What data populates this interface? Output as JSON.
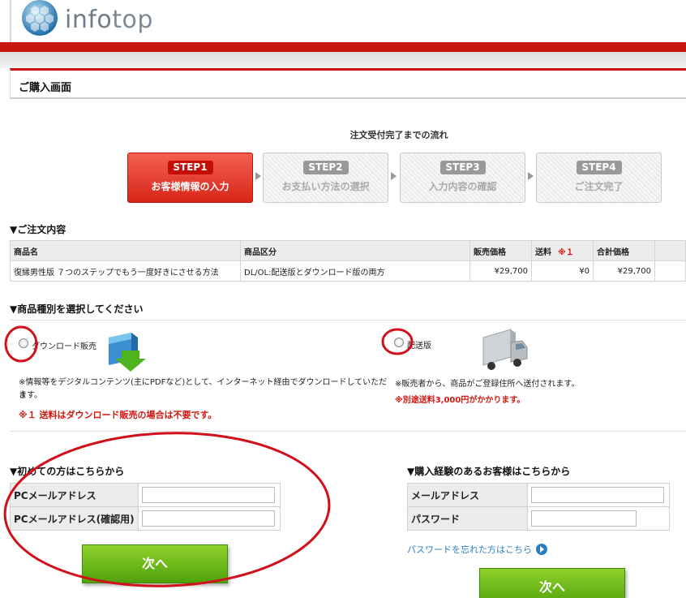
{
  "header": {
    "logo_text_main": "info",
    "logo_text_accent": "top"
  },
  "page_title": "ご購入画面",
  "flow": {
    "title": "注文受付完了までの流れ",
    "steps": [
      {
        "badge": "STEP1",
        "label": "お客様情報の入力",
        "active": true
      },
      {
        "badge": "STEP2",
        "label": "お支払い方法の選択",
        "active": false
      },
      {
        "badge": "STEP3",
        "label": "入力内容の確認",
        "active": false
      },
      {
        "badge": "STEP4",
        "label": "ご注文完了",
        "active": false
      }
    ]
  },
  "order": {
    "heading": "▼ご注文内容",
    "columns": [
      "商品名",
      "商品区分",
      "販売価格",
      "送料",
      "※１",
      "合計価格"
    ],
    "row": {
      "name": "復縁男性版 ７つのステップでもう一度好きにさせる方法",
      "category": "DL/OL:配送版とダウンロード版の両方",
      "price": "¥29,700",
      "shipping": "¥0",
      "total": "¥29,700"
    }
  },
  "product_type": {
    "heading": "▼商品種別を選択してください",
    "download_label": "ダウンロード販売",
    "download_note": "※情報等をデジタルコンテンツ(主にPDFなど)として、インターネット経由でダウンロードしていただき",
    "download_note2": "ます。",
    "shipping_note_red": "※１ 送料はダウンロード販売の場合は不要です。",
    "delivery_label": "配送版",
    "delivery_note": "※販売者から、商品がご登録住所へ送付されます。",
    "delivery_note_red": "※別途送料3,000円がかかります。"
  },
  "new_customer": {
    "heading": "▼初めての方はこちらから",
    "email_label": "PCメールアドレス",
    "email_value": "",
    "email_confirm_label": "PCメールアドレス(確認用)",
    "email_confirm_value": "",
    "next_label": "次へ"
  },
  "returning_customer": {
    "heading": "▼購入経験のあるお客様はこちらから",
    "email_label": "メールアドレス",
    "email_value": "",
    "password_label": "パスワード",
    "password_value": "",
    "forgot_label": "パスワードを忘れた方はこちら",
    "next_label": "次へ"
  },
  "colors": {
    "brand_red": "#c8150d",
    "button_green": "#6ab81a",
    "link_blue": "#2a7fc4",
    "annotation_red": "#d0101a"
  }
}
